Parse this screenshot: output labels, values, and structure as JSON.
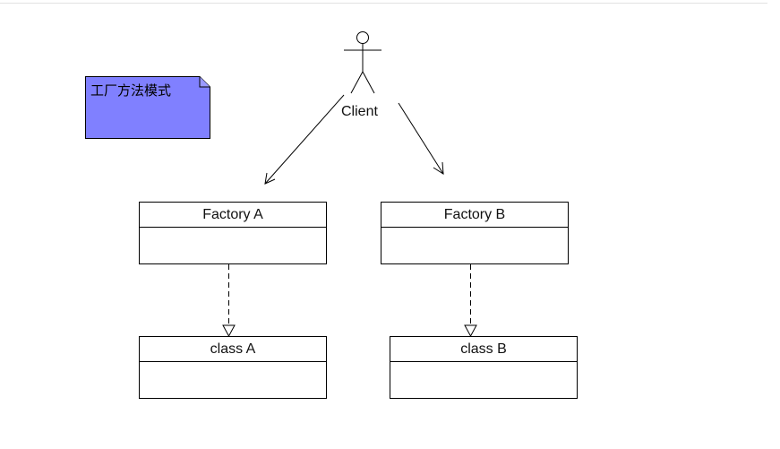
{
  "diagram": {
    "note": {
      "text": "工厂方法模式",
      "fill": "#8080ff"
    },
    "actor": {
      "label": "Client"
    },
    "classes": [
      {
        "name": "Factory A"
      },
      {
        "name": "Factory B"
      },
      {
        "name": "class A"
      },
      {
        "name": "class B"
      }
    ],
    "relations": [
      {
        "from": "Client",
        "to": "Factory A",
        "type": "association"
      },
      {
        "from": "Client",
        "to": "Factory B",
        "type": "association"
      },
      {
        "from": "Factory A",
        "to": "class A",
        "type": "realization"
      },
      {
        "from": "Factory B",
        "to": "class B",
        "type": "realization"
      }
    ]
  }
}
